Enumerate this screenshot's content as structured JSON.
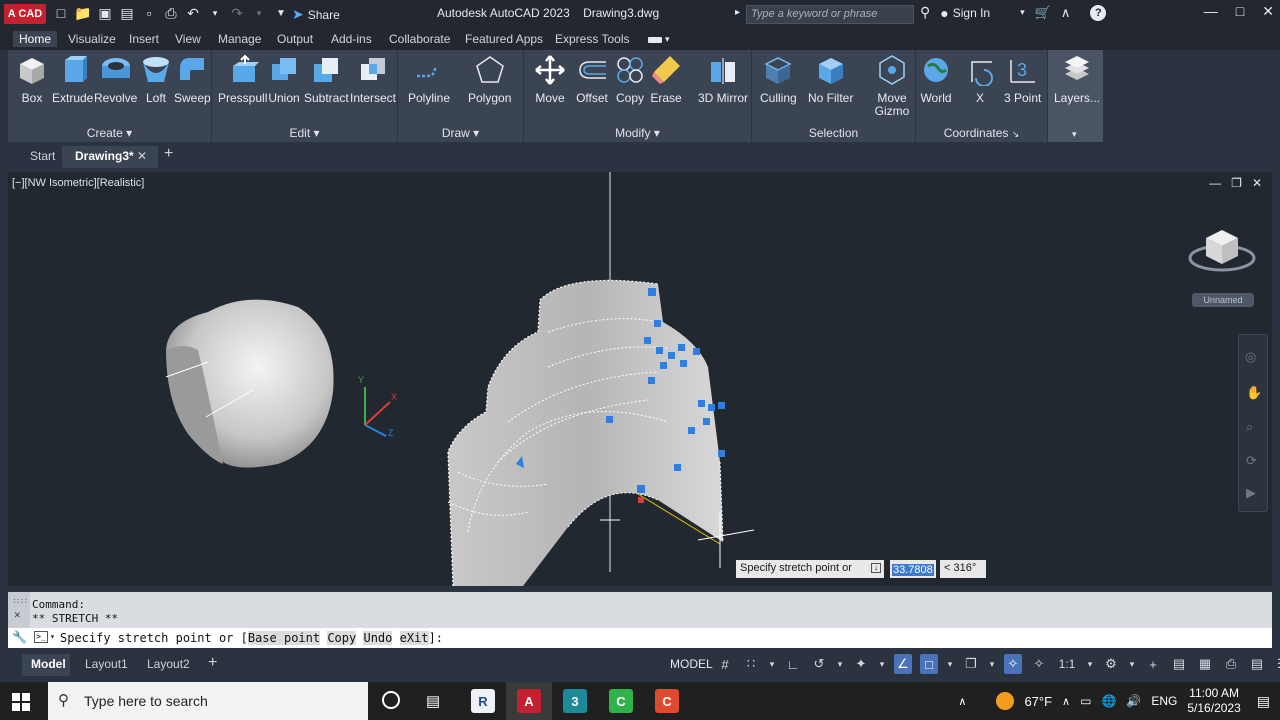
{
  "titlebar": {
    "app_logo": "A CAD",
    "share_label": "Share",
    "title": "Autodesk AutoCAD 2023    Drawing3.dwg",
    "search_placeholder": "Type a keyword or phrase",
    "sign_in": "Sign In"
  },
  "ribbon_tabs": [
    "Home",
    "Visualize",
    "Insert",
    "View",
    "Manage",
    "Output",
    "Add-ins",
    "Collaborate",
    "Featured Apps",
    "Express Tools"
  ],
  "ribbon": {
    "create": {
      "title": "Create",
      "buttons": [
        "Box",
        "Extrude",
        "Revolve",
        "Loft",
        "Sweep"
      ]
    },
    "edit": {
      "title": "Edit",
      "buttons": [
        "Presspull",
        "Union",
        "Subtract",
        "Intersect"
      ]
    },
    "draw": {
      "title": "Draw",
      "buttons": [
        "Polyline",
        "Polygon"
      ]
    },
    "modify": {
      "title": "Modify",
      "buttons": [
        "Move",
        "Offset",
        "Copy",
        "Erase",
        "3D Mirror"
      ]
    },
    "selection": {
      "title": "Selection",
      "buttons": [
        "Culling",
        "No Filter",
        "Move Gizmo"
      ]
    },
    "coordinates": {
      "title": "Coordinates",
      "buttons": [
        "World",
        "X",
        "3 Point"
      ]
    },
    "layers": {
      "title": "Layers..."
    }
  },
  "doc_tabs": {
    "start": "Start",
    "active": "Drawing3*"
  },
  "viewport": {
    "label": "[−][NW Isometric][Realistic]",
    "viewcube_label": "Unnamed",
    "tooltip_prompt": "Specify stretch point or",
    "tooltip_value": "33.7808",
    "tooltip_angle": "< 316°"
  },
  "command": {
    "history": [
      "Command:",
      "** STRETCH **"
    ],
    "prompt_prefix": "Specify stretch point or [",
    "options": [
      "Base point",
      "Copy",
      "Undo",
      "eXit"
    ],
    "prompt_suffix": "]:"
  },
  "layout_tabs": [
    "Model",
    "Layout1",
    "Layout2"
  ],
  "status": {
    "model": "MODEL",
    "scale": "1:1"
  },
  "taskbar": {
    "search": "Type here to search",
    "weather": "67°F",
    "lang": "ENG",
    "time": "11:00 AM",
    "date": "5/16/2023"
  },
  "colors": {
    "accent": "#3c79d3",
    "grip": "#2f7fe0",
    "ribbon_bg": "#3b4453",
    "viewport_bg": "#212830"
  }
}
